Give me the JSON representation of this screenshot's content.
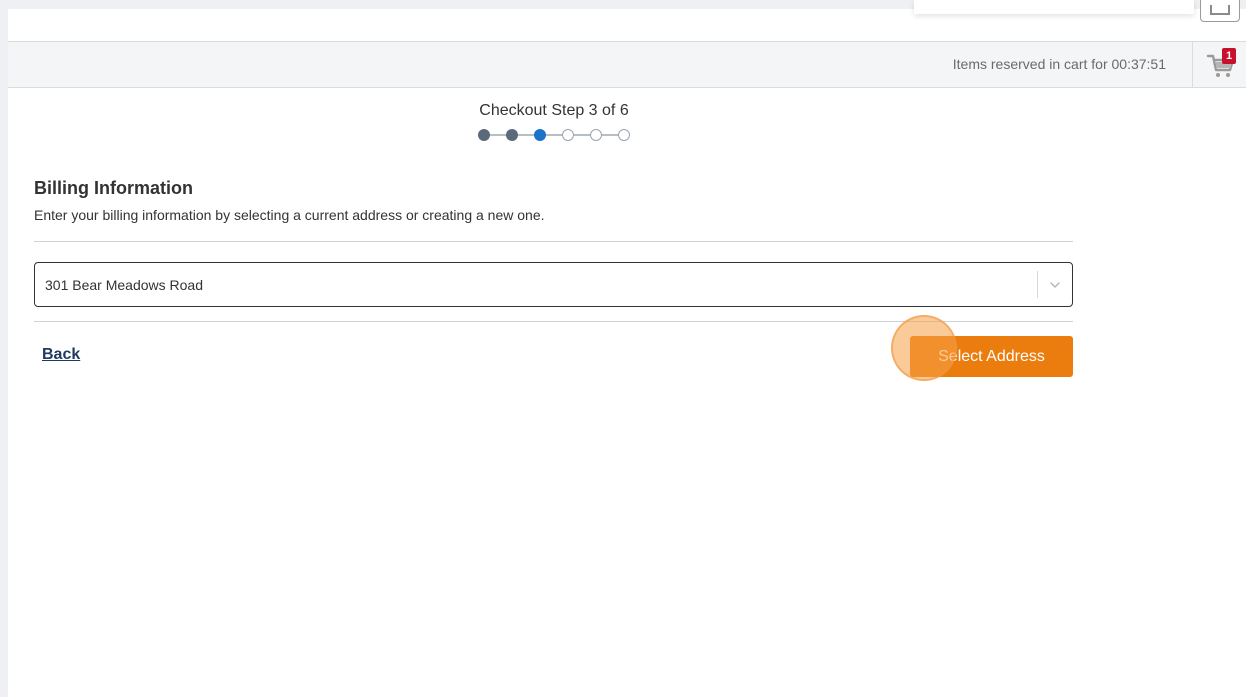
{
  "cart_bar": {
    "timer_text": "Items reserved in cart for 00:37:51",
    "cart_count": "1"
  },
  "checkout": {
    "step_text": "Checkout Step 3 of 6",
    "current_step": 3,
    "total_steps": 6
  },
  "billing": {
    "title": "Billing Information",
    "subtitle": "Enter your billing information by selecting a current address or creating a new one.",
    "address_value": "301 Bear Meadows Road"
  },
  "actions": {
    "back_label": "Back",
    "select_label": "Select Address"
  },
  "colors": {
    "accent": "#ea7d0e",
    "step_completed": "#5a6a7a",
    "step_current": "#1a73c8",
    "badge": "#c8102e",
    "link": "#1f3a5f"
  }
}
